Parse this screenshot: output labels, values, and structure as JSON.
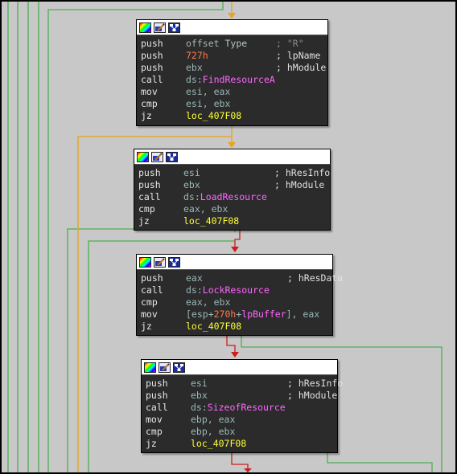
{
  "colors": {
    "edge_green": "#4caf50",
    "edge_orange": "#e8a317",
    "edge_red": "#cc1e1e",
    "block_bg": "#2b2b2b",
    "canvas_bg": "#c8c8c8"
  },
  "header_icons": [
    "color-picker-icon",
    "rename-pencil-icon",
    "graph-view-icon"
  ],
  "blocks": [
    {
      "lines": [
        {
          "mnem": "push",
          "op_parts": [
            {
              "t": "offset ",
              "c": "c-gray"
            },
            {
              "t": "Type",
              "c": "c-kw"
            }
          ],
          "comment": "; \"R\"",
          "comment_style": "cmg"
        },
        {
          "mnem": "push",
          "op_parts": [
            {
              "t": "727h",
              "c": "c-num"
            }
          ],
          "comment": "; lpName",
          "comment_style": "cm"
        },
        {
          "mnem": "push",
          "op_parts": [
            {
              "t": "ebx",
              "c": "op"
            }
          ],
          "comment": "; hModule",
          "comment_style": "cm"
        },
        {
          "mnem": "call",
          "op_parts": [
            {
              "t": "ds:",
              "c": "op"
            },
            {
              "t": "FindResourceA",
              "c": "c-api"
            }
          ],
          "comment": "",
          "comment_style": "cm"
        },
        {
          "mnem": "mov",
          "op_parts": [
            {
              "t": "esi, eax",
              "c": "op"
            }
          ],
          "comment": "",
          "comment_style": "cm"
        },
        {
          "mnem": "cmp",
          "op_parts": [
            {
              "t": "esi, ebx",
              "c": "op"
            }
          ],
          "comment": "",
          "comment_style": "cm"
        },
        {
          "mnem": "jz",
          "op_parts": [
            {
              "t": "loc_407F08",
              "c": "c-loc"
            }
          ],
          "comment": "",
          "comment_style": "cm"
        }
      ]
    },
    {
      "lines": [
        {
          "mnem": "push",
          "op_parts": [
            {
              "t": "esi",
              "c": "op"
            }
          ],
          "comment": "; hResInfo",
          "comment_style": "cm"
        },
        {
          "mnem": "push",
          "op_parts": [
            {
              "t": "ebx",
              "c": "op"
            }
          ],
          "comment": "; hModule",
          "comment_style": "cm"
        },
        {
          "mnem": "call",
          "op_parts": [
            {
              "t": "ds:",
              "c": "op"
            },
            {
              "t": "LoadResource",
              "c": "c-api"
            }
          ],
          "comment": "",
          "comment_style": "cm"
        },
        {
          "mnem": "cmp",
          "op_parts": [
            {
              "t": "eax, ebx",
              "c": "op"
            }
          ],
          "comment": "",
          "comment_style": "cm"
        },
        {
          "mnem": "jz",
          "op_parts": [
            {
              "t": "loc_407F08",
              "c": "c-loc"
            }
          ],
          "comment": "",
          "comment_style": "cm"
        }
      ]
    },
    {
      "lines": [
        {
          "mnem": "push",
          "op_parts": [
            {
              "t": "eax",
              "c": "op"
            }
          ],
          "comment": "; hResData",
          "comment_style": "cm"
        },
        {
          "mnem": "call",
          "op_parts": [
            {
              "t": "ds:",
              "c": "op"
            },
            {
              "t": "LockResource",
              "c": "c-api"
            }
          ],
          "comment": "",
          "comment_style": "cm"
        },
        {
          "mnem": "cmp",
          "op_parts": [
            {
              "t": "eax, ebx",
              "c": "op"
            }
          ],
          "comment": "",
          "comment_style": "cm"
        },
        {
          "mnem": "mov",
          "op_parts": [
            {
              "t": "[esp+",
              "c": "op"
            },
            {
              "t": "270h",
              "c": "c-num"
            },
            {
              "t": "+",
              "c": "op"
            },
            {
              "t": "lpBuffer",
              "c": "c-api"
            },
            {
              "t": "], eax",
              "c": "op"
            }
          ],
          "comment": "",
          "comment_style": "cm"
        },
        {
          "mnem": "jz",
          "op_parts": [
            {
              "t": "loc_407F08",
              "c": "c-loc"
            }
          ],
          "comment": "",
          "comment_style": "cm"
        }
      ]
    },
    {
      "lines": [
        {
          "mnem": "push",
          "op_parts": [
            {
              "t": "esi",
              "c": "op"
            }
          ],
          "comment": "; hResInfo",
          "comment_style": "cm"
        },
        {
          "mnem": "push",
          "op_parts": [
            {
              "t": "ebx",
              "c": "op"
            }
          ],
          "comment": "; hModule",
          "comment_style": "cm"
        },
        {
          "mnem": "call",
          "op_parts": [
            {
              "t": "ds:",
              "c": "op"
            },
            {
              "t": "SizeofResource",
              "c": "c-api"
            }
          ],
          "comment": "",
          "comment_style": "cm"
        },
        {
          "mnem": "mov",
          "op_parts": [
            {
              "t": "ebp, eax",
              "c": "op"
            }
          ],
          "comment": "",
          "comment_style": "cm"
        },
        {
          "mnem": "cmp",
          "op_parts": [
            {
              "t": "ebp, ebx",
              "c": "op"
            }
          ],
          "comment": "",
          "comment_style": "cm"
        },
        {
          "mnem": "jz",
          "op_parts": [
            {
              "t": "loc_407F08",
              "c": "c-loc"
            }
          ],
          "comment": "",
          "comment_style": "cm"
        }
      ]
    }
  ]
}
